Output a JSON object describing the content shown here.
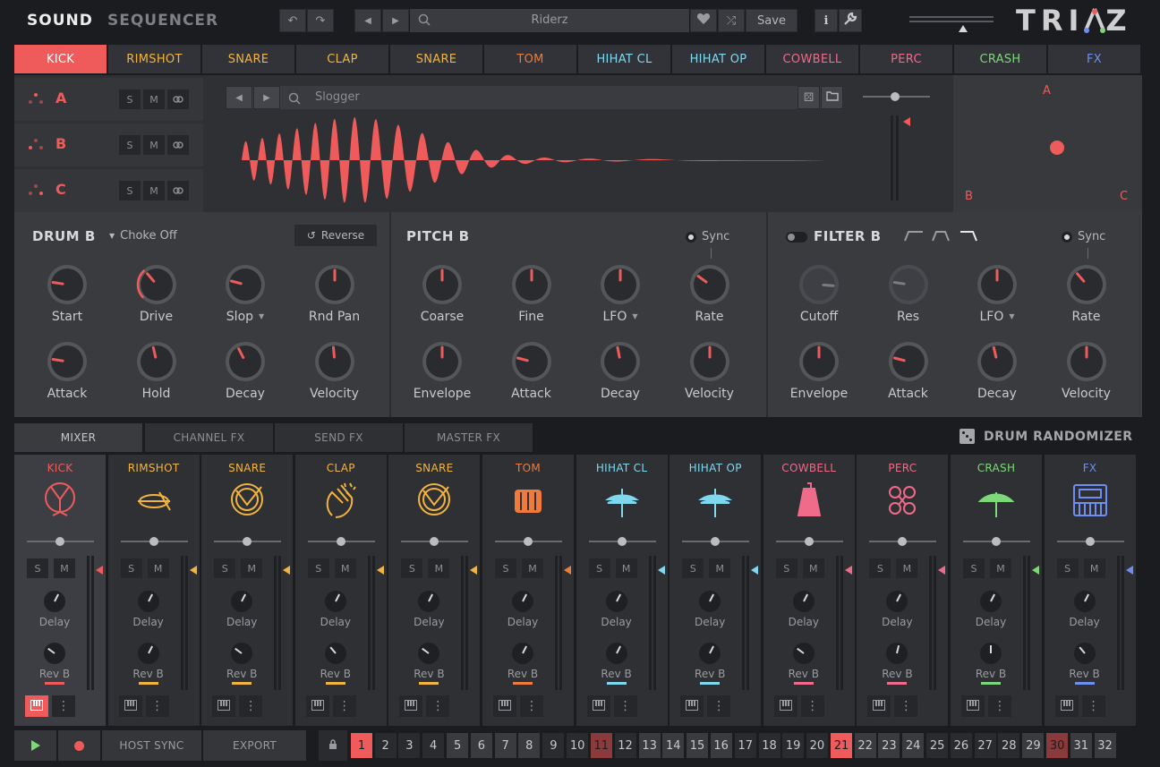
{
  "header": {
    "tabs": [
      {
        "label": "SOUND",
        "active": true
      },
      {
        "label": "SEQUENCER",
        "active": false
      }
    ],
    "preset_name": "Riderz",
    "save_label": "Save",
    "logo": "TRIAZ",
    "icons": [
      "undo-icon",
      "redo-icon",
      "prev-icon",
      "next-icon",
      "search-icon",
      "heart-icon",
      "shuffle-icon",
      "info-icon",
      "wrench-icon"
    ]
  },
  "pads": [
    {
      "label": "KICK",
      "color": "#ef5b5b",
      "active": true
    },
    {
      "label": "RIMSHOT",
      "color": "#f2b440"
    },
    {
      "label": "SNARE",
      "color": "#f2b440"
    },
    {
      "label": "CLAP",
      "color": "#f2b440"
    },
    {
      "label": "SNARE",
      "color": "#f2b440"
    },
    {
      "label": "TOM",
      "color": "#ef7a3a"
    },
    {
      "label": "HIHAT CL",
      "color": "#7fd8ee"
    },
    {
      "label": "HIHAT OP",
      "color": "#7fd8ee"
    },
    {
      "label": "COWBELL",
      "color": "#f06a8a"
    },
    {
      "label": "PERC",
      "color": "#f06a8a"
    },
    {
      "label": "CRASH",
      "color": "#7ed77a"
    },
    {
      "label": "FX",
      "color": "#6e8ef2"
    }
  ],
  "layers": [
    {
      "label": "A",
      "s": "S",
      "m": "M"
    },
    {
      "label": "B",
      "s": "S",
      "m": "M"
    },
    {
      "label": "C",
      "s": "S",
      "m": "M"
    }
  ],
  "sample_browser": {
    "sample_name": "Slogger"
  },
  "xy_pad": {
    "a": "A",
    "b": "B",
    "c": "C",
    "point_x": 0.55,
    "point_y": 0.53
  },
  "drum": {
    "title": "DRUM B",
    "choke": "Choke Off",
    "reverse": "Reverse",
    "knobs": [
      {
        "label": "Start",
        "value": 0.2,
        "arc": false
      },
      {
        "label": "Drive",
        "value": 0.35,
        "arc": true
      },
      {
        "label": "Slop",
        "value": 0.22,
        "arc": false,
        "dropdown": true
      },
      {
        "label": "Rnd Pan",
        "value": 0.5,
        "arc": false
      },
      {
        "label": "Attack",
        "value": 0.2,
        "arc": false
      },
      {
        "label": "Hold",
        "value": 0.45,
        "arc": false
      },
      {
        "label": "Decay",
        "value": 0.4,
        "arc": false
      },
      {
        "label": "Velocity",
        "value": 0.48,
        "arc": false
      }
    ]
  },
  "pitch": {
    "title": "PITCH B",
    "sync": "Sync",
    "knobs": [
      {
        "label": "Coarse",
        "value": 0.5
      },
      {
        "label": "Fine",
        "value": 0.5
      },
      {
        "label": "LFO",
        "value": 0.5,
        "dropdown": true
      },
      {
        "label": "Rate",
        "value": 0.3
      },
      {
        "label": "Envelope",
        "value": 0.5
      },
      {
        "label": "Attack",
        "value": 0.22
      },
      {
        "label": "Decay",
        "value": 0.46
      },
      {
        "label": "Velocity",
        "value": 0.5
      }
    ]
  },
  "filter": {
    "title": "FILTER B",
    "sync": "Sync",
    "knobs": [
      {
        "label": "Cutoff",
        "value": 0.85,
        "muted": true
      },
      {
        "label": "Res",
        "value": 0.2,
        "muted": true
      },
      {
        "label": "LFO",
        "value": 0.5,
        "dropdown": true
      },
      {
        "label": "Rate",
        "value": 0.35
      },
      {
        "label": "Envelope",
        "value": 0.5
      },
      {
        "label": "Attack",
        "value": 0.22
      },
      {
        "label": "Decay",
        "value": 0.45
      },
      {
        "label": "Velocity",
        "value": 0.5
      }
    ]
  },
  "bottom_tabs": [
    {
      "label": "MIXER",
      "active": true
    },
    {
      "label": "CHANNEL FX"
    },
    {
      "label": "SEND FX"
    },
    {
      "label": "MASTER FX"
    }
  ],
  "drum_randomizer": "DRUM RANDOMIZER",
  "mixer": {
    "s": "S",
    "m": "M",
    "delay": "Delay",
    "rev": "Rev B",
    "channels": [
      {
        "name": "KICK",
        "color": "#ef5b5b",
        "icon": "kick-drum-icon",
        "delay": 0.6,
        "rev": 0.3
      },
      {
        "name": "RIMSHOT",
        "color": "#f2b440",
        "icon": "rimshot-icon",
        "delay": 0.6,
        "rev": 0.6
      },
      {
        "name": "SNARE",
        "color": "#f2b440",
        "icon": "snare-icon",
        "delay": 0.6,
        "rev": 0.3
      },
      {
        "name": "CLAP",
        "color": "#f2b440",
        "icon": "clap-icon",
        "delay": 0.6,
        "rev": 0.35
      },
      {
        "name": "SNARE",
        "color": "#f2b440",
        "icon": "snare-icon",
        "delay": 0.6,
        "rev": 0.3
      },
      {
        "name": "TOM",
        "color": "#ef7a3a",
        "icon": "tom-icon",
        "delay": 0.6,
        "rev": 0.6
      },
      {
        "name": "HIHAT CL",
        "color": "#7fd8ee",
        "icon": "hihat-closed-icon",
        "delay": 0.6,
        "rev": 0.6
      },
      {
        "name": "HIHAT OP",
        "color": "#7fd8ee",
        "icon": "hihat-open-icon",
        "delay": 0.6,
        "rev": 0.6
      },
      {
        "name": "COWBELL",
        "color": "#f06a8a",
        "icon": "cowbell-icon",
        "delay": 0.6,
        "rev": 0.3
      },
      {
        "name": "PERC",
        "color": "#f06a8a",
        "icon": "perc-icon",
        "delay": 0.6,
        "rev": 0.55
      },
      {
        "name": "CRASH",
        "color": "#7ed77a",
        "icon": "crash-icon",
        "delay": 0.6,
        "rev": 0.5
      },
      {
        "name": "FX",
        "color": "#6e8ef2",
        "icon": "fx-synth-icon",
        "delay": 0.6,
        "rev": 0.35
      }
    ]
  },
  "transport": {
    "sync_label": "HOST SYNC",
    "export_label": "EXPORT",
    "steps": [
      "1",
      "2",
      "3",
      "4",
      "5",
      "6",
      "7",
      "8",
      "9",
      "10",
      "11",
      "12",
      "13",
      "14",
      "15",
      "16",
      "17",
      "18",
      "19",
      "20",
      "21",
      "22",
      "23",
      "24",
      "25",
      "26",
      "27",
      "28",
      "29",
      "30",
      "31",
      "32"
    ],
    "active_steps": [
      1,
      21
    ],
    "dim_steps": [
      11,
      30
    ]
  }
}
